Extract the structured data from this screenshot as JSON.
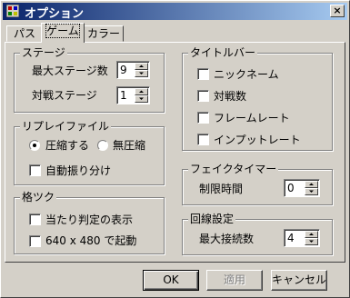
{
  "window": {
    "title": "オプション",
    "close_glyph": "×"
  },
  "tabs": [
    {
      "label": "パス",
      "active": false
    },
    {
      "label": "ゲーム",
      "active": true
    },
    {
      "label": "カラー",
      "active": false
    }
  ],
  "stage": {
    "title": "ステージ",
    "max_label": "最大ステージ数",
    "max_value": "9",
    "vs_label": "対戦ステージ",
    "vs_value": "1"
  },
  "replay": {
    "title": "リプレイファイル",
    "compress_label": "圧縮する",
    "nocompress_label": "無圧縮",
    "auto_split_label": "自動振り分け",
    "selected": "compress"
  },
  "fighting": {
    "title": "格ツク",
    "hit_display_label": "当たり判定の表示",
    "res_label": "640 x 480 で起動"
  },
  "titlebar_group": {
    "title": "タイトルバー",
    "items": [
      "ニックネーム",
      "対戦数",
      "フレームレート",
      "インプットレート"
    ]
  },
  "fake_timer": {
    "title": "フェイクタイマー",
    "limit_label": "制限時間",
    "limit_value": "0"
  },
  "line": {
    "title": "回線設定",
    "max_conn_label": "最大接続数",
    "max_conn_value": "4"
  },
  "buttons": {
    "ok": "OK",
    "apply": "適用",
    "cancel": "キャンセル"
  }
}
